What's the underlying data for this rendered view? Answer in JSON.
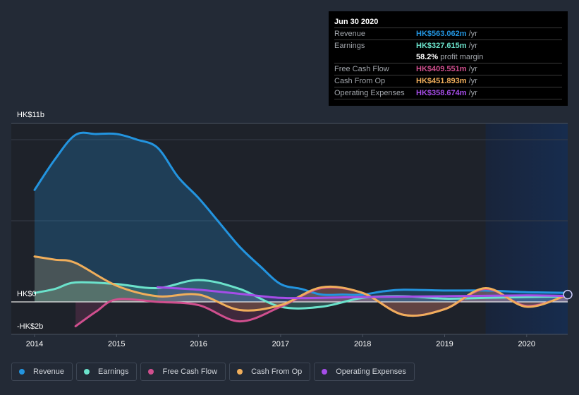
{
  "tooltip": {
    "date": "Jun 30 2020",
    "rows": [
      {
        "label": "Revenue",
        "value": "HK$563.062m",
        "unit": "/yr",
        "color": "#2394df"
      },
      {
        "label": "Earnings",
        "value": "HK$327.615m",
        "unit": "/yr",
        "color": "#6be2cb"
      },
      {
        "label": "",
        "value": "58.2%",
        "unit": "profit margin",
        "color": "#ffffff"
      },
      {
        "label": "Free Cash Flow",
        "value": "HK$409.551m",
        "unit": "/yr",
        "color": "#d04f8e"
      },
      {
        "label": "Cash From Op",
        "value": "HK$451.893m",
        "unit": "/yr",
        "color": "#f0ae5b"
      },
      {
        "label": "Operating Expenses",
        "value": "HK$358.674m",
        "unit": "/yr",
        "color": "#a54de8"
      }
    ]
  },
  "legend": [
    {
      "label": "Revenue",
      "color": "#2394df"
    },
    {
      "label": "Earnings",
      "color": "#6be2cb"
    },
    {
      "label": "Free Cash Flow",
      "color": "#d04f8e"
    },
    {
      "label": "Cash From Op",
      "color": "#f0ae5b"
    },
    {
      "label": "Operating Expenses",
      "color": "#a54de8"
    }
  ],
  "chart_data": {
    "type": "area",
    "title": "",
    "xlabel": "",
    "ylabel": "",
    "units": "HK$ billions",
    "x_ticks": [
      "2014",
      "2015",
      "2016",
      "2017",
      "2018",
      "2019",
      "2020"
    ],
    "y_tick_labels": [
      {
        "value": 11,
        "label": "HK$11b"
      },
      {
        "value": 0,
        "label": "HK$0"
      },
      {
        "value": -2,
        "label": "-HK$2b"
      }
    ],
    "xlim": [
      2013.7,
      2020.5
    ],
    "ylim": [
      -2,
      11
    ],
    "gridlines_y": [
      10,
      5
    ],
    "grid": true,
    "highlight_region": [
      2019.5,
      2020.5
    ],
    "legend_position": "bottom",
    "series": [
      {
        "name": "Revenue",
        "color": "#2394df",
        "x": [
          2014.0,
          2014.25,
          2014.5,
          2014.75,
          2015.0,
          2015.25,
          2015.5,
          2015.75,
          2016.0,
          2016.25,
          2016.5,
          2016.75,
          2017.0,
          2017.25,
          2017.5,
          2017.75,
          2018.0,
          2018.25,
          2018.5,
          2019.0,
          2019.5,
          2020.0,
          2020.5
        ],
        "values": [
          6.9,
          8.8,
          10.3,
          10.35,
          10.35,
          10.0,
          9.5,
          7.7,
          6.4,
          4.9,
          3.4,
          2.2,
          1.1,
          0.8,
          0.45,
          0.45,
          0.45,
          0.65,
          0.75,
          0.7,
          0.7,
          0.6,
          0.56
        ]
      },
      {
        "name": "Earnings",
        "color": "#6be2cb",
        "x": [
          2014.0,
          2014.25,
          2014.5,
          2015.0,
          2015.5,
          2016.0,
          2016.5,
          2017.0,
          2017.5,
          2018.0,
          2018.5,
          2019.0,
          2019.5,
          2020.0,
          2020.5
        ],
        "values": [
          0.55,
          0.8,
          1.2,
          1.1,
          0.85,
          1.35,
          0.8,
          -0.3,
          -0.3,
          0.25,
          0.35,
          0.2,
          0.25,
          0.3,
          0.33
        ]
      },
      {
        "name": "Free Cash Flow",
        "color": "#d04f8e",
        "x": [
          2014.5,
          2014.75,
          2015.0,
          2015.5,
          2016.0,
          2016.5,
          2017.0,
          2017.5,
          2018.0,
          2018.5,
          2019.0,
          2019.5,
          2020.0,
          2020.5
        ],
        "values": [
          -1.5,
          -0.6,
          0.15,
          0.0,
          -0.2,
          -1.2,
          -0.3,
          0.85,
          0.55,
          -0.8,
          -0.45,
          0.8,
          -0.25,
          0.41
        ]
      },
      {
        "name": "Cash From Op",
        "color": "#f0ae5b",
        "x": [
          2014.0,
          2014.25,
          2014.5,
          2015.0,
          2015.5,
          2016.0,
          2016.5,
          2017.0,
          2017.5,
          2018.0,
          2018.5,
          2019.0,
          2019.5,
          2020.0,
          2020.5
        ],
        "values": [
          2.8,
          2.6,
          2.4,
          1.0,
          0.35,
          0.45,
          -0.5,
          -0.2,
          0.9,
          0.55,
          -0.8,
          -0.45,
          0.85,
          -0.3,
          0.45
        ]
      },
      {
        "name": "Operating Expenses",
        "color": "#a54de8",
        "x": [
          2015.5,
          2016.0,
          2016.5,
          2017.0,
          2017.5,
          2018.0,
          2019.0,
          2020.0,
          2020.5
        ],
        "values": [
          0.9,
          0.75,
          0.5,
          0.25,
          0.25,
          0.3,
          0.35,
          0.4,
          0.36
        ]
      }
    ]
  }
}
